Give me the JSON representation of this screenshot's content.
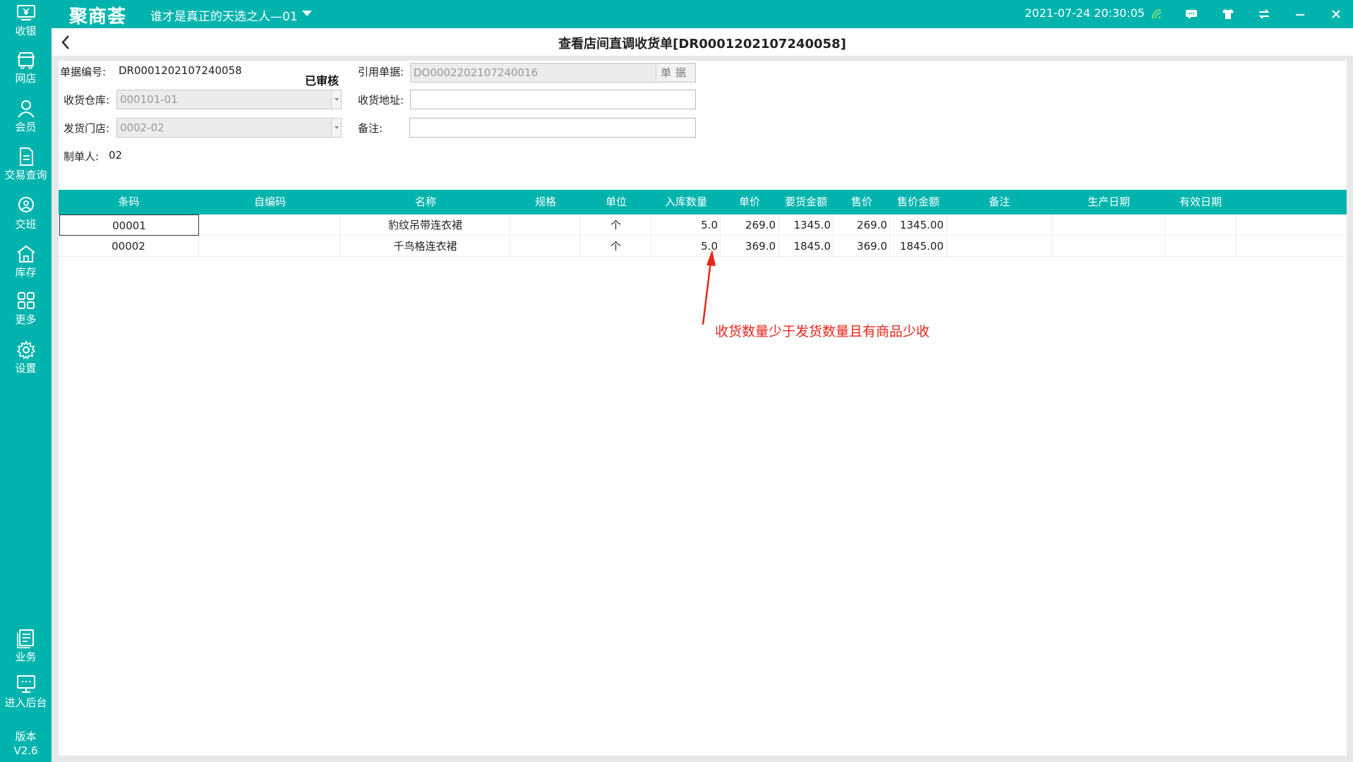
{
  "app": {
    "logo": "聚商荟",
    "store_name": "谁才是真正的天选之人—01",
    "datetime": "2021-07-24 20:30:05",
    "accent_color": "#00b4ad",
    "annotation_color": "#e8261b"
  },
  "topbar_icons": [
    "wifi-signal-icon",
    "message-icon",
    "skin-tshirt-icon",
    "sync-arrows-icon",
    "minimize-icon",
    "close-icon"
  ],
  "sidebar": {
    "items": [
      {
        "label": "收银",
        "icon": "cashier-icon"
      },
      {
        "label": "网店",
        "icon": "online-store-icon"
      },
      {
        "label": "会员",
        "icon": "member-icon"
      },
      {
        "label": "交易查询",
        "icon": "transaction-icon"
      },
      {
        "label": "交班",
        "icon": "shift-handover-icon"
      },
      {
        "label": "库存",
        "icon": "inventory-icon"
      },
      {
        "label": "更多",
        "icon": "more-grid-icon"
      },
      {
        "label": "设置",
        "icon": "settings-gear-icon"
      },
      {
        "label": "业务",
        "icon": "business-icon"
      },
      {
        "label": "进入后台",
        "icon": "backend-monitor-icon"
      }
    ],
    "version_label": "版本",
    "version": "V2.6"
  },
  "header": {
    "title": "查看店间直调收货单[DR0001202107240058]"
  },
  "form": {
    "doc_no_label": "单据编号:",
    "doc_no": "DR0001202107240058",
    "status": "已审核",
    "warehouse_label": "收货仓库:",
    "warehouse_value": "000101-01",
    "store_label": "发货门店:",
    "store_value": "0002-02",
    "creator_label": "制单人:",
    "creator": "02",
    "ref_label": "引用单据:",
    "ref_value": "DO0002202107240016",
    "ref_button": "单据",
    "address_label": "收货地址:",
    "address_value": "",
    "remark_label": "备注:",
    "remark_value": ""
  },
  "table": {
    "columns": [
      "条码",
      "自编码",
      "名称",
      "规格",
      "单位",
      "入库数量",
      "单价",
      "要货金额",
      "售价",
      "售价金额",
      "备注",
      "生产日期",
      "有效日期"
    ],
    "rows": [
      {
        "barcode": "00001",
        "selfcode": "",
        "name": "豹纹吊带连衣裙",
        "spec": "",
        "unit": "个",
        "qty": "5.0",
        "price": "269.0",
        "amount": "1345.0",
        "sale_price": "269.0",
        "sale_amount": "1345.00",
        "remark": "",
        "prod_date": "",
        "exp_date": ""
      },
      {
        "barcode": "00002",
        "selfcode": "",
        "name": "千鸟格连衣裙",
        "spec": "",
        "unit": "个",
        "qty": "5.0",
        "price": "369.0",
        "amount": "1845.0",
        "sale_price": "369.0",
        "sale_amount": "1845.00",
        "remark": "",
        "prod_date": "",
        "exp_date": ""
      }
    ]
  },
  "annotation": {
    "text": "收货数量少于发货数量且有商品少收"
  }
}
